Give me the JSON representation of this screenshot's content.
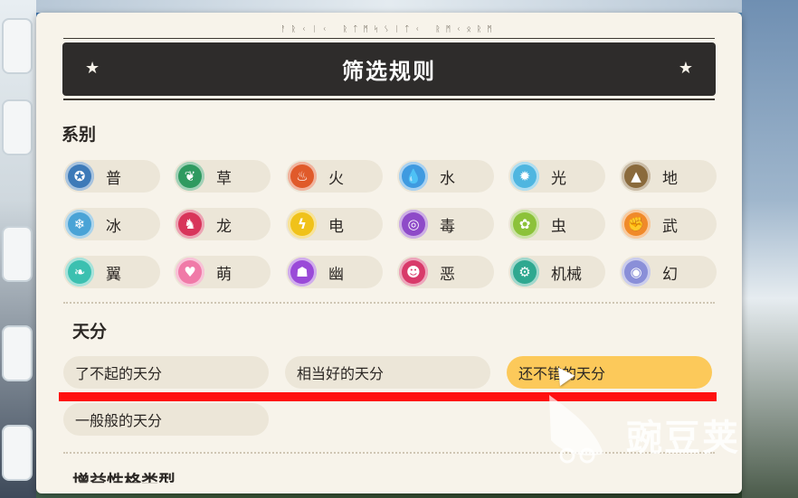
{
  "header": {
    "rune_text": "ᚨᚱᚲᛁᚲ ᚱᛏᛗᛋᛊᛁᛏᚲ ᚱᛗᚲᛟᚱᛗ",
    "title": "筛选规则",
    "star_icon": "star-icon"
  },
  "sections": {
    "types_title": "系别",
    "talent_title": "天分",
    "next_title_partial": "增益性格类型"
  },
  "types": [
    {
      "label": "普",
      "icon": "normal-type-icon",
      "color": "#3d7ab8",
      "glyph": "✪"
    },
    {
      "label": "草",
      "icon": "grass-type-icon",
      "color": "#2f9a60",
      "glyph": "❦"
    },
    {
      "label": "火",
      "icon": "fire-type-icon",
      "color": "#e05a2a",
      "glyph": "♨"
    },
    {
      "label": "水",
      "icon": "water-type-icon",
      "color": "#3f9ae0",
      "glyph": "💧"
    },
    {
      "label": "光",
      "icon": "light-type-icon",
      "color": "#4fb6e0",
      "glyph": "✹"
    },
    {
      "label": "地",
      "icon": "ground-type-icon",
      "color": "#8a6a3c",
      "glyph": "▲"
    },
    {
      "label": "冰",
      "icon": "ice-type-icon",
      "color": "#4aa3d6",
      "glyph": "❄"
    },
    {
      "label": "龙",
      "icon": "dragon-type-icon",
      "color": "#d8355a",
      "glyph": "♞"
    },
    {
      "label": "电",
      "icon": "electric-type-icon",
      "color": "#f0c21a",
      "glyph": "ϟ"
    },
    {
      "label": "毒",
      "icon": "poison-type-icon",
      "color": "#8e4ac8",
      "glyph": "◎"
    },
    {
      "label": "虫",
      "icon": "bug-type-icon",
      "color": "#8cc23a",
      "glyph": "✿"
    },
    {
      "label": "武",
      "icon": "fighting-type-icon",
      "color": "#f08a2a",
      "glyph": "✊"
    },
    {
      "label": "翼",
      "icon": "wing-type-icon",
      "color": "#3cc0b0",
      "glyph": "❧"
    },
    {
      "label": "萌",
      "icon": "cute-type-icon",
      "color": "#f07aa8",
      "glyph": "♥"
    },
    {
      "label": "幽",
      "icon": "ghost-type-icon",
      "color": "#9a4ad8",
      "glyph": "☗"
    },
    {
      "label": "恶",
      "icon": "dark-type-icon",
      "color": "#d83a6a",
      "glyph": "☻"
    },
    {
      "label": "机械",
      "icon": "mechanical-type-icon",
      "color": "#2fa890",
      "glyph": "⚙"
    },
    {
      "label": "幻",
      "icon": "illusion-type-icon",
      "color": "#8a8fd8",
      "glyph": "◉"
    }
  ],
  "talents": [
    {
      "label": "了不起的天分",
      "active": false
    },
    {
      "label": "相当好的天分",
      "active": false
    },
    {
      "label": "还不错的天分",
      "active": true
    },
    {
      "label": "一般般的天分",
      "active": false
    }
  ],
  "watermark": {
    "text": "豌豆荚"
  },
  "colors": {
    "panel_bg": "#f7f3ea",
    "title_bar_bg": "#2e2c2b",
    "chip_bg": "#ece6d8",
    "active_chip_bg": "#fcc95a",
    "annotation_line": "#ff1010"
  }
}
